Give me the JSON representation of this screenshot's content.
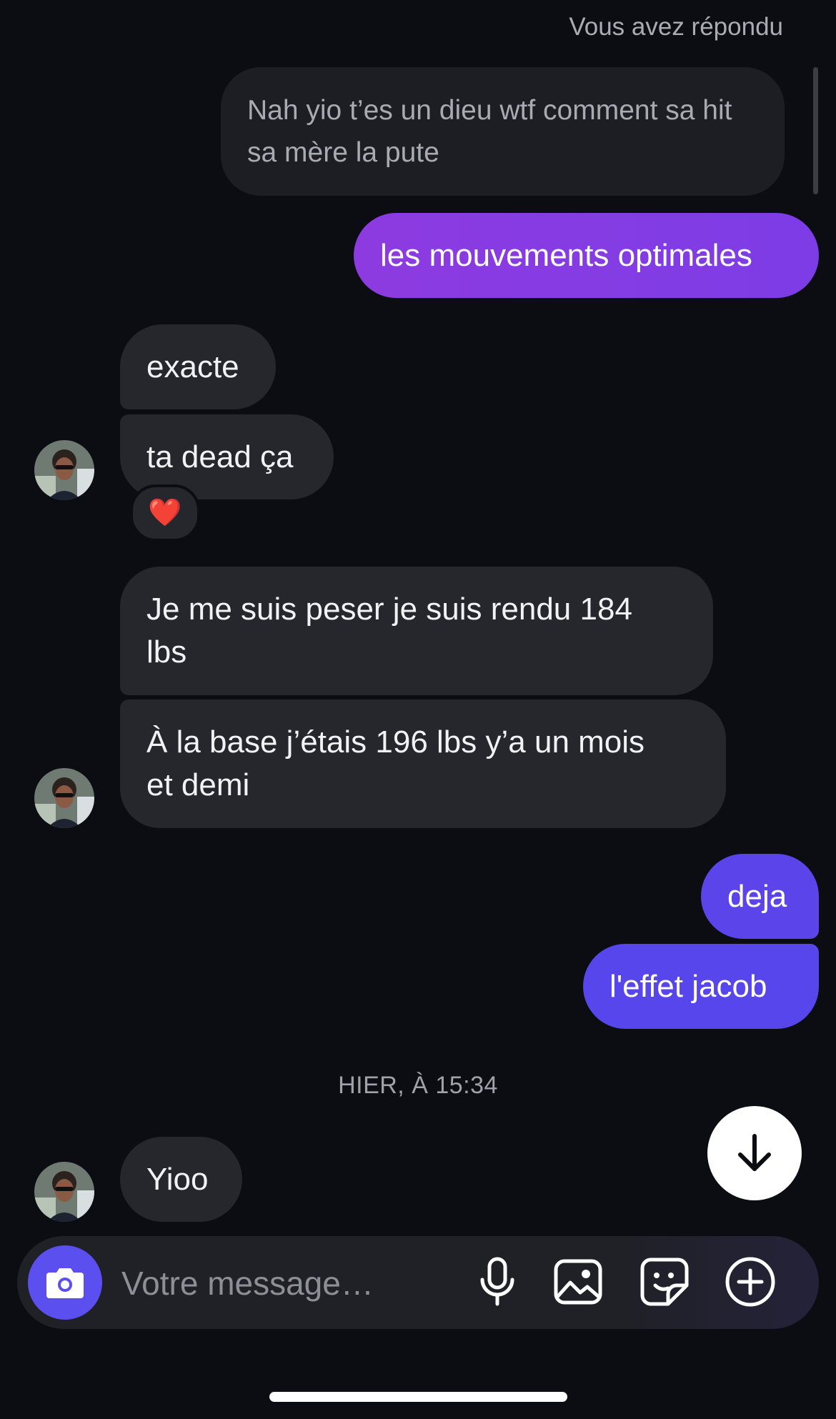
{
  "conversation": {
    "reply_label": "Vous avez répondu",
    "quoted_message": "Nah yio t’es un dieu wtf comment sa hit sa mère la pute",
    "messages": [
      {
        "from": "me",
        "text": "les mouvements optimales"
      },
      {
        "from": "them",
        "text": "exacte"
      },
      {
        "from": "them",
        "text": "ta dead ça",
        "reaction": "❤️"
      },
      {
        "from": "them",
        "text": "Je me suis peser je suis rendu 184\nlbs"
      },
      {
        "from": "them",
        "text": "À la base j’étais 196 lbs y’a un mois\net demi"
      },
      {
        "from": "me",
        "text": "deja"
      },
      {
        "from": "me",
        "text": "l'effet jacob"
      },
      {
        "from": "them",
        "text": "Yioo"
      }
    ],
    "date_separator": "HIER, À 15:34"
  },
  "composer": {
    "placeholder": "Votre message…",
    "icons": [
      "camera-icon",
      "microphone-icon",
      "image-icon",
      "sticker-icon",
      "plus-circle-icon"
    ]
  },
  "colors": {
    "background": "#0b0d12",
    "incoming_bubble": "#25272d",
    "outgoing_purple": "#8d3be0",
    "outgoing_indigo": "#5b45ea",
    "camera_button": "#5b4ff0"
  }
}
